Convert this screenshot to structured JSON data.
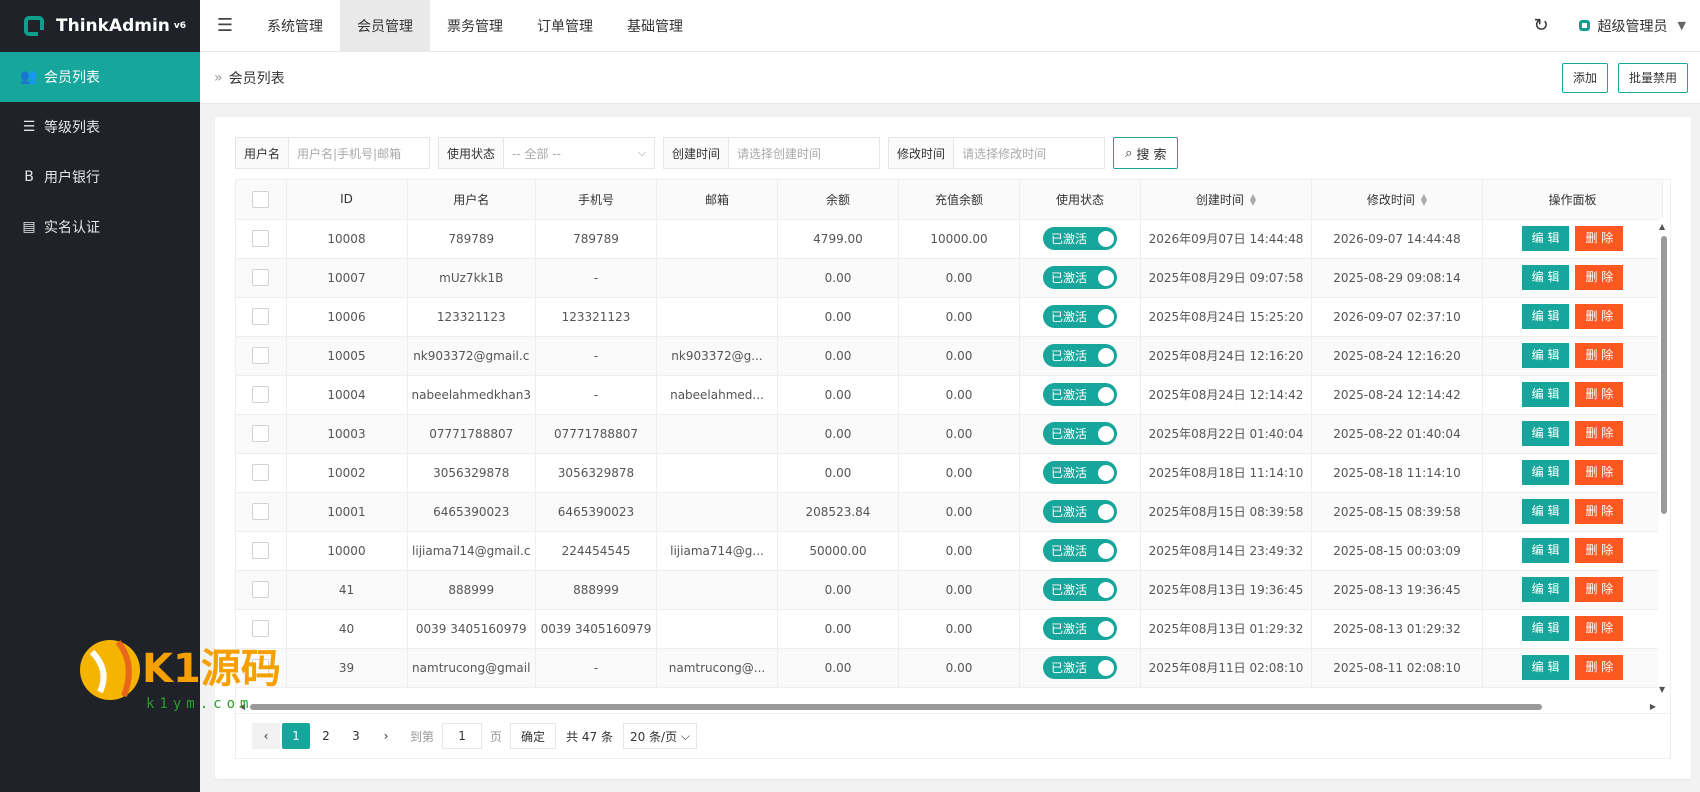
{
  "app": {
    "name": "ThinkAdmin",
    "version": "v6"
  },
  "sidebar": {
    "items": [
      {
        "label": "会员列表",
        "icon": "users-icon",
        "glyph": "👥",
        "active": true
      },
      {
        "label": "等级列表",
        "icon": "list-icon",
        "glyph": "☰",
        "active": false
      },
      {
        "label": "用户银行",
        "icon": "bank-icon",
        "glyph": "B",
        "active": false
      },
      {
        "label": "实名认证",
        "icon": "idcard-icon",
        "glyph": "▤",
        "active": false
      }
    ]
  },
  "header": {
    "tabs": [
      "系统管理",
      "会员管理",
      "票务管理",
      "订单管理",
      "基础管理"
    ],
    "active_tab": 1,
    "user": "超级管理员"
  },
  "breadcrumb": {
    "current": "会员列表"
  },
  "actions": {
    "add": "添加",
    "batch_disable": "批量禁用"
  },
  "search": {
    "username_label": "用户名",
    "username_placeholder": "用户名|手机号|邮箱",
    "status_label": "使用状态",
    "status_value": "-- 全部 --",
    "created_label": "创建时间",
    "created_placeholder": "请选择创建时间",
    "modified_label": "修改时间",
    "modified_placeholder": "请选择修改时间",
    "button": "搜 索"
  },
  "table": {
    "columns": [
      "ID",
      "用户名",
      "手机号",
      "邮箱",
      "余额",
      "充值余额",
      "使用状态",
      "创建时间",
      "修改时间",
      "操作面板"
    ],
    "status_label": "已激活",
    "edit_label": "编 辑",
    "delete_label": "删 除",
    "rows": [
      {
        "id": "10008",
        "username": "789789",
        "phone": "789789",
        "email": "",
        "balance": "4799.00",
        "recharge": "10000.00",
        "created": "2026年09月07日 14:44:48",
        "modified": "2026-09-07 14:44:48"
      },
      {
        "id": "10007",
        "username": "mUz7kk1B",
        "phone": "-",
        "email": "",
        "balance": "0.00",
        "recharge": "0.00",
        "created": "2025年08月29日 09:07:58",
        "modified": "2025-08-29 09:08:14"
      },
      {
        "id": "10006",
        "username": "123321123",
        "phone": "123321123",
        "email": "",
        "balance": "0.00",
        "recharge": "0.00",
        "created": "2025年08月24日 15:25:20",
        "modified": "2026-09-07 02:37:10"
      },
      {
        "id": "10005",
        "username": "nk903372@gmail.c",
        "phone": "-",
        "email": "nk903372@g...",
        "balance": "0.00",
        "recharge": "0.00",
        "created": "2025年08月24日 12:16:20",
        "modified": "2025-08-24 12:16:20"
      },
      {
        "id": "10004",
        "username": "nabeelahmedkhan3",
        "phone": "-",
        "email": "nabeelahmed...",
        "balance": "0.00",
        "recharge": "0.00",
        "created": "2025年08月24日 12:14:42",
        "modified": "2025-08-24 12:14:42"
      },
      {
        "id": "10003",
        "username": "07771788807",
        "phone": "07771788807",
        "email": "",
        "balance": "0.00",
        "recharge": "0.00",
        "created": "2025年08月22日 01:40:04",
        "modified": "2025-08-22 01:40:04"
      },
      {
        "id": "10002",
        "username": "3056329878",
        "phone": "3056329878",
        "email": "",
        "balance": "0.00",
        "recharge": "0.00",
        "created": "2025年08月18日 11:14:10",
        "modified": "2025-08-18 11:14:10"
      },
      {
        "id": "10001",
        "username": "6465390023",
        "phone": "6465390023",
        "email": "",
        "balance": "208523.84",
        "recharge": "0.00",
        "created": "2025年08月15日 08:39:58",
        "modified": "2025-08-15 08:39:58"
      },
      {
        "id": "10000",
        "username": "lijiama714@gmail.c",
        "phone": "224454545",
        "email": "lijiama714@g...",
        "balance": "50000.00",
        "recharge": "0.00",
        "created": "2025年08月14日 23:49:32",
        "modified": "2025-08-15 00:03:09"
      },
      {
        "id": "41",
        "username": "888999",
        "phone": "888999",
        "email": "",
        "balance": "0.00",
        "recharge": "0.00",
        "created": "2025年08月13日 19:36:45",
        "modified": "2025-08-13 19:36:45"
      },
      {
        "id": "40",
        "username": "0039 3405160979",
        "phone": "0039 3405160979",
        "email": "",
        "balance": "0.00",
        "recharge": "0.00",
        "created": "2025年08月13日 01:29:32",
        "modified": "2025-08-13 01:29:32"
      },
      {
        "id": "39",
        "username": "namtrucong@gmail",
        "phone": "-",
        "email": "namtrucong@...",
        "balance": "0.00",
        "recharge": "0.00",
        "created": "2025年08月11日 02:08:10",
        "modified": "2025-08-11 02:08:10"
      }
    ]
  },
  "pager": {
    "pages": [
      "1",
      "2",
      "3"
    ],
    "current": "1",
    "goto_label": "到第",
    "goto_value": "1",
    "page_unit": "页",
    "confirm": "确定",
    "total": "共 47 条",
    "page_size": "20 条/页"
  },
  "watermark": {
    "text": "K1源码",
    "sub": "k1ym.com"
  },
  "colors": {
    "primary": "#16a69b",
    "danger": "#ff5722",
    "sidebar": "#20222a"
  }
}
